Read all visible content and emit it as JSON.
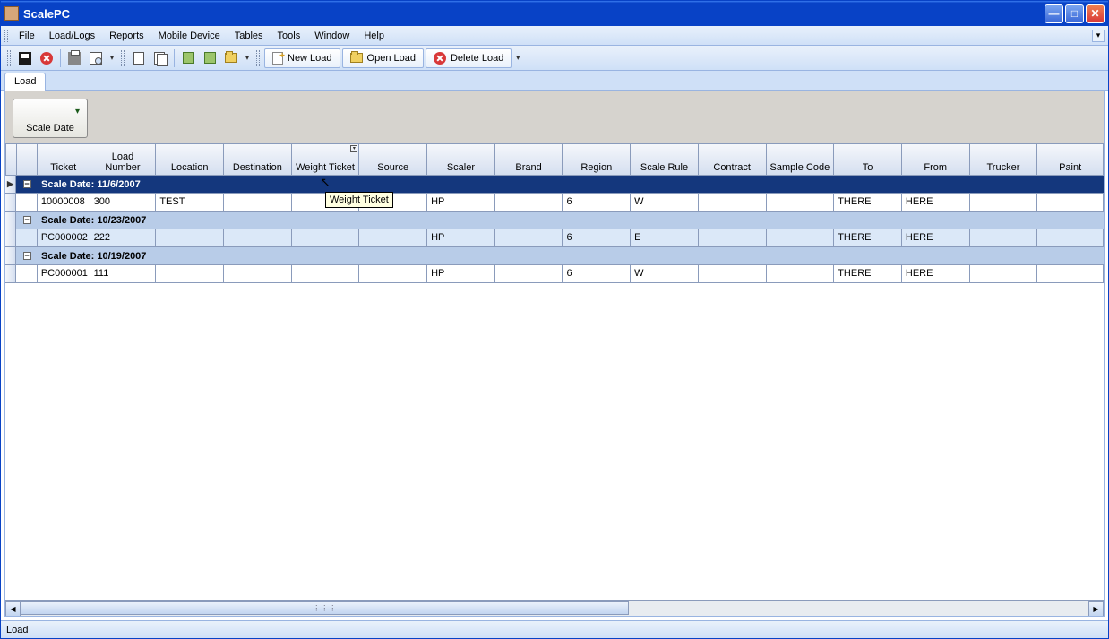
{
  "window": {
    "title": "ScalePC"
  },
  "menu": [
    "File",
    "Load/Logs",
    "Reports",
    "Mobile Device",
    "Tables",
    "Tools",
    "Window",
    "Help"
  ],
  "toolbar_buttons": {
    "new_load": "New Load",
    "open_load": "Open Load",
    "delete_load": "Delete Load"
  },
  "tab": "Load",
  "groupbox": {
    "label": "Scale Date"
  },
  "columns": [
    "Ticket",
    "Load Number",
    "Location",
    "Destination",
    "Weight Ticket",
    "Source",
    "Scaler",
    "Brand",
    "Region",
    "Scale Rule",
    "Contract",
    "Sample Code",
    "To",
    "From",
    "Trucker",
    "Paint"
  ],
  "tooltip": "Weight Ticket",
  "groups": [
    {
      "label": "Scale Date: 11/6/2007",
      "selected": true,
      "rows": [
        {
          "ticket": "10000008",
          "loadnum": "300",
          "location": "TEST",
          "dest": "",
          "weight": "",
          "source": "",
          "scaler": "HP",
          "brand": "",
          "region": "6",
          "scalerule": "W",
          "contract": "",
          "sample": "",
          "to": "THERE",
          "from": "HERE",
          "trucker": "",
          "paint": ""
        }
      ]
    },
    {
      "label": "Scale Date: 10/23/2007",
      "selected": false,
      "rows": [
        {
          "ticket": "PC000002",
          "loadnum": "222",
          "location": "",
          "dest": "",
          "weight": "",
          "source": "",
          "scaler": "HP",
          "brand": "",
          "region": "6",
          "scalerule": "E",
          "contract": "",
          "sample": "",
          "to": "THERE",
          "from": "HERE",
          "trucker": "",
          "paint": ""
        }
      ]
    },
    {
      "label": "Scale Date: 10/19/2007",
      "selected": false,
      "rows": [
        {
          "ticket": "PC000001",
          "loadnum": "111",
          "location": "",
          "dest": "",
          "weight": "",
          "source": "",
          "scaler": "HP",
          "brand": "",
          "region": "6",
          "scalerule": "W",
          "contract": "",
          "sample": "",
          "to": "THERE",
          "from": "HERE",
          "trucker": "",
          "paint": ""
        }
      ]
    }
  ],
  "status": "Load"
}
